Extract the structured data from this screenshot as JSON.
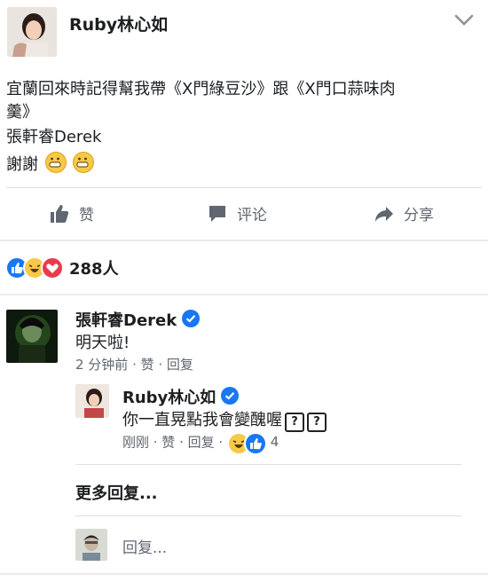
{
  "post": {
    "author": "Ruby林心如",
    "text_line1": "宜蘭回來時記得幫我帶《X門綠豆沙》跟《X門口蒜味肉",
    "text_line2": "羹》",
    "mention": "張軒睿Derek",
    "thanks": "謝謝"
  },
  "actions": {
    "like": "赞",
    "comment": "评论",
    "share": "分享"
  },
  "reactions": {
    "count": "288人"
  },
  "comment1": {
    "author": "張軒睿Derek",
    "text": "明天啦!",
    "meta": "2 分钟前 · 赞 · 回复"
  },
  "reply1": {
    "author": "Ruby林心如",
    "text": "你一直晃點我會變醜喔",
    "qmark": "?",
    "meta": "刚刚 · 赞 · 回复 ·",
    "reaction_count": "4"
  },
  "more_replies": "更多回复...",
  "reply_box": {
    "placeholder": "回复..."
  },
  "colors": {
    "accent": "#1877f2",
    "text": "#1c1e21",
    "muted": "#606770",
    "divider": "#dddfe2"
  }
}
